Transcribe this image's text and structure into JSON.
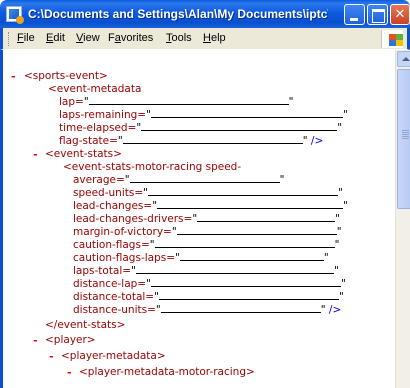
{
  "window": {
    "title": "C:\\Documents and Settings\\Alan\\My Documents\\iptc\\sports..."
  },
  "menu": {
    "items": [
      {
        "label": "File",
        "underline": "F"
      },
      {
        "label": "Edit",
        "underline": "E"
      },
      {
        "label": "View",
        "underline": "V"
      },
      {
        "label": "Favorites",
        "underline": "a"
      },
      {
        "label": "Tools",
        "underline": "T"
      },
      {
        "label": "Help",
        "underline": "H"
      }
    ]
  },
  "xml": {
    "sports_event_open": "<sports-event>",
    "event_metadata_open": "<event-metadata",
    "event_metadata_attrs": [
      "lap=",
      "laps-remaining=",
      "time-elapsed=",
      "flag-state="
    ],
    "self_close": "/>",
    "event_stats_open": "<event-stats>",
    "event_stats_motor_open": "<event-stats-motor-racing speed-",
    "event_stats_attrs": [
      "average=",
      "speed-units=",
      "lead-changes=",
      "lead-changes-drivers=",
      "margin-of-victory=",
      "caution-flags=",
      "caution-flags-laps=",
      "laps-total=",
      "distance-lap=",
      "distance-total=",
      "distance-units="
    ],
    "event_stats_close": "</event-stats>",
    "player_open": "<player>",
    "player_metadata_open": "<player-metadata>",
    "player_metadata_motor_open": "<player-metadata-motor-racing>"
  },
  "colors": {
    "titlebar": "#0a5ddd",
    "menubar": "#ece9d8",
    "tag": "#990000",
    "collapse_minus": "#ff0000"
  },
  "icons": {
    "app": "ie-document-icon",
    "minimize": "minimize-icon",
    "maximize": "maximize-icon",
    "close": "close-icon",
    "flag": "windows-flag-icon"
  }
}
